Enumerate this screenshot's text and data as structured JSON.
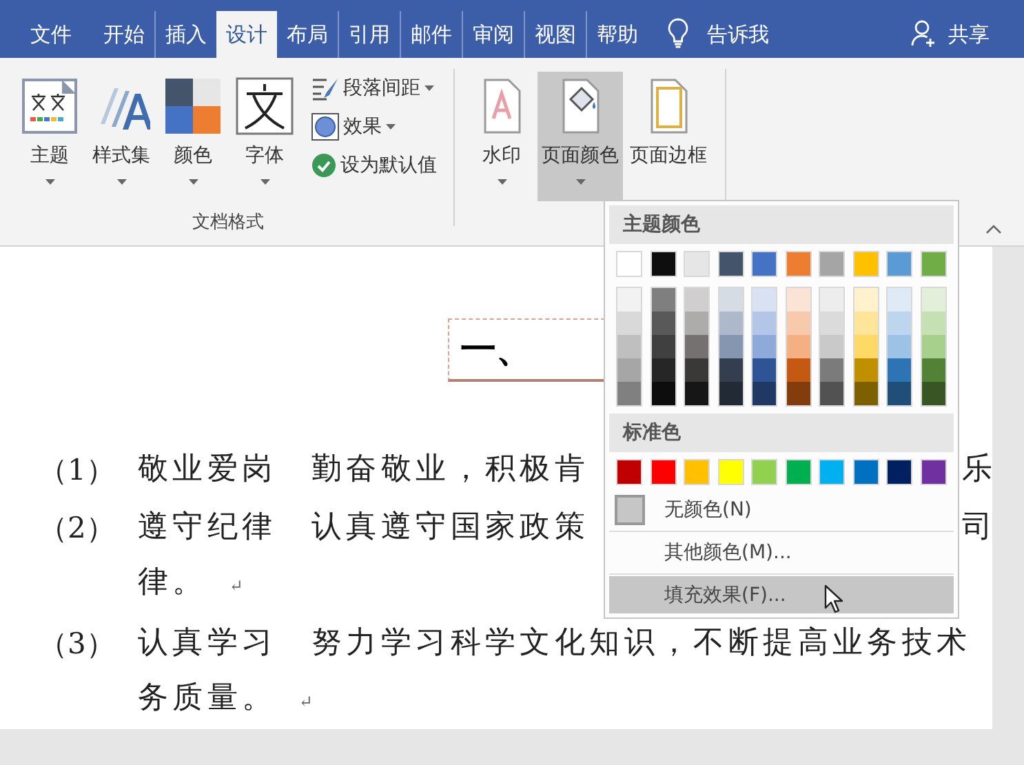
{
  "tabs": [
    {
      "label": "文件",
      "selected": false
    },
    {
      "label": "开始",
      "selected": false
    },
    {
      "label": "插入",
      "selected": false
    },
    {
      "label": "设计",
      "selected": true
    },
    {
      "label": "布局",
      "selected": false
    },
    {
      "label": "引用",
      "selected": false
    },
    {
      "label": "邮件",
      "selected": false
    },
    {
      "label": "审阅",
      "selected": false
    },
    {
      "label": "视图",
      "selected": false
    },
    {
      "label": "帮助",
      "selected": false
    }
  ],
  "tell_me": {
    "label": "告诉我"
  },
  "share": {
    "label": "共享"
  },
  "document_format": {
    "label": "文档格式",
    "large_buttons": [
      {
        "label": "主题",
        "kind": "theme",
        "dropdown": true
      },
      {
        "label": "样式集",
        "kind": "styles",
        "dropdown": true
      },
      {
        "label": "颜色",
        "kind": "colors",
        "dropdown": true
      },
      {
        "label": "字体",
        "kind": "fonts",
        "dropdown": true
      }
    ],
    "small_buttons": [
      {
        "label": "段落间距",
        "kind": "spacing",
        "dropdown": true
      },
      {
        "label": "效果",
        "kind": "effects",
        "dropdown": true
      },
      {
        "label": "设为默认值",
        "kind": "default",
        "dropdown": false
      }
    ]
  },
  "page_background": {
    "buttons": [
      {
        "label": "水印",
        "kind": "watermark",
        "dropdown": true,
        "selected": false
      },
      {
        "label": "页面颜色",
        "kind": "page_color",
        "dropdown": true,
        "selected": true
      },
      {
        "label": "页面边框",
        "kind": "page_border",
        "dropdown": false,
        "selected": false
      }
    ]
  },
  "color_menu": {
    "theme_header": "主题颜色",
    "theme_colors": [
      {
        "color": "#ffffff",
        "shades": [
          {
            "color": "#f2f2f2"
          },
          {
            "color": "#d9d9d9"
          },
          {
            "color": "#bfbfbf"
          },
          {
            "color": "#a6a6a6"
          },
          {
            "color": "#808080"
          }
        ]
      },
      {
        "color": "#0e0e0e",
        "shades": [
          {
            "color": "#7f7f7f"
          },
          {
            "color": "#595959"
          },
          {
            "color": "#404040"
          },
          {
            "color": "#262626"
          },
          {
            "color": "#0d0d0d"
          }
        ]
      },
      {
        "color": "#e7e6e6",
        "shades": [
          {
            "color": "#d0cece"
          },
          {
            "color": "#aeabab"
          },
          {
            "color": "#757171"
          },
          {
            "color": "#3b3838"
          },
          {
            "color": "#171616"
          }
        ]
      },
      {
        "color": "#44546a",
        "shades": [
          {
            "color": "#d6dce4"
          },
          {
            "color": "#adb9ca"
          },
          {
            "color": "#8496b0"
          },
          {
            "color": "#333f4f"
          },
          {
            "color": "#222a35"
          }
        ]
      },
      {
        "color": "#4472c4",
        "shades": [
          {
            "color": "#d9e2f3"
          },
          {
            "color": "#b4c6e7"
          },
          {
            "color": "#8eaadb"
          },
          {
            "color": "#2f5496"
          },
          {
            "color": "#1f3864"
          }
        ]
      },
      {
        "color": "#ed7d31",
        "shades": [
          {
            "color": "#fbe4d5"
          },
          {
            "color": "#f7caac"
          },
          {
            "color": "#f4b083"
          },
          {
            "color": "#c45911"
          },
          {
            "color": "#833c0b"
          }
        ]
      },
      {
        "color": "#a5a5a5",
        "shades": [
          {
            "color": "#ededed"
          },
          {
            "color": "#dbdbdb"
          },
          {
            "color": "#c9c9c9"
          },
          {
            "color": "#7b7b7b"
          },
          {
            "color": "#525252"
          }
        ]
      },
      {
        "color": "#ffc000",
        "shades": [
          {
            "color": "#fff2cc"
          },
          {
            "color": "#ffe599"
          },
          {
            "color": "#ffd966"
          },
          {
            "color": "#bf8f00"
          },
          {
            "color": "#7f6000"
          }
        ]
      },
      {
        "color": "#5b9bd5",
        "shades": [
          {
            "color": "#deeaf6"
          },
          {
            "color": "#bdd6ee"
          },
          {
            "color": "#9cc3e5"
          },
          {
            "color": "#2e74b5"
          },
          {
            "color": "#1f4e79"
          }
        ]
      },
      {
        "color": "#70ad47",
        "shades": [
          {
            "color": "#e2efd9"
          },
          {
            "color": "#c5e0b3"
          },
          {
            "color": "#a8d08d"
          },
          {
            "color": "#538135"
          },
          {
            "color": "#375623"
          }
        ]
      }
    ],
    "standard_header": "标准色",
    "standard_colors": [
      {
        "color": "#c00000"
      },
      {
        "color": "#ff0000"
      },
      {
        "color": "#ffc000"
      },
      {
        "color": "#ffff00"
      },
      {
        "color": "#92d050"
      },
      {
        "color": "#00b050"
      },
      {
        "color": "#00b0f0"
      },
      {
        "color": "#0070c0"
      },
      {
        "color": "#002060"
      },
      {
        "color": "#7030a0"
      }
    ],
    "items": [
      {
        "label": "无颜色(N)",
        "kind": "no_color",
        "selected": false
      },
      {
        "label": "其他颜色(M)...",
        "kind": "more",
        "selected": false
      },
      {
        "label": "填充效果(F)...",
        "kind": "fill",
        "selected": true
      }
    ]
  },
  "document": {
    "title": "一、",
    "paragraphs": [
      {
        "number": "（1）",
        "lines": [
          {
            "text": "敬业爱岗　勤奋敬业，积极肯",
            "tail": "乐"
          }
        ]
      },
      {
        "number": "（2）",
        "lines": [
          {
            "text": "遵守纪律　认真遵守国家政策",
            "tail": "司"
          },
          {
            "text": "律。",
            "end_mark": "↵"
          }
        ]
      },
      {
        "number": "（3）",
        "lines": [
          {
            "text": "认真学习　努力学习科学文化知识，不断提高业务技术"
          },
          {
            "text": "务质量。",
            "end_mark": "↵"
          }
        ]
      }
    ]
  }
}
